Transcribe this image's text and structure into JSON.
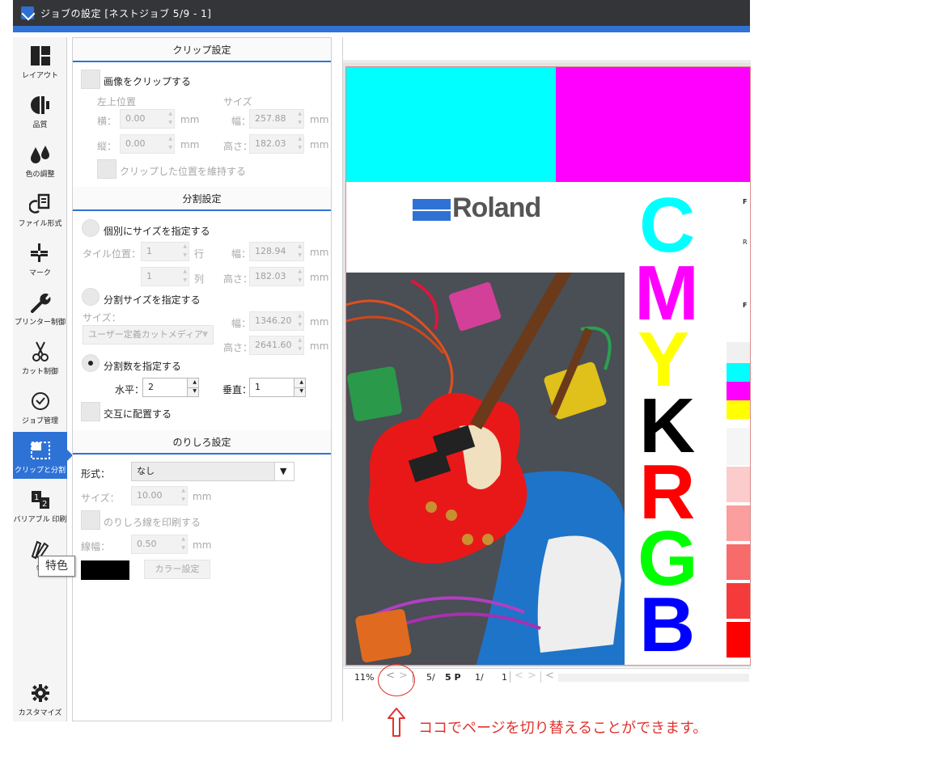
{
  "window": {
    "title": "ジョブの設定 [ネストジョブ 5/9 - 1]"
  },
  "nav": {
    "items": [
      {
        "label": "レイアウト",
        "icon": "layout-icon"
      },
      {
        "label": "品質",
        "icon": "quality-icon"
      },
      {
        "label": "色の調整",
        "icon": "color-drops-icon"
      },
      {
        "label": "ファイル形式",
        "icon": "file-format-icon"
      },
      {
        "label": "マーク",
        "icon": "crop-marks-icon"
      },
      {
        "label": "プリンター制御",
        "icon": "wrench-icon"
      },
      {
        "label": "カット制御",
        "icon": "scissors-icon"
      },
      {
        "label": "ジョブ管理",
        "icon": "clock-icon"
      },
      {
        "label": "クリップと分割",
        "icon": "clip-split-icon",
        "active": true
      },
      {
        "label": "バリアブル 印刷",
        "icon": "variable-print-icon"
      },
      {
        "label": "特",
        "icon": "spot-color-icon"
      }
    ],
    "customize_label": "カスタマイズ"
  },
  "tooltip": "特色",
  "clip": {
    "header": "クリップ設定",
    "clip_image": "画像をクリップする",
    "top_left": "左上位置",
    "size": "サイズ",
    "x_label": "横：",
    "y_label": "縦：",
    "w_label": "幅：",
    "h_label": "高さ：",
    "x": "0.00",
    "y": "0.00",
    "w": "257.88",
    "h": "182.03",
    "unit": "mm",
    "keep_pos": "クリップした位置を維持する"
  },
  "split": {
    "header": "分割設定",
    "individual": "個別にサイズを指定する",
    "tile_pos": "タイル位置：",
    "row_val": "1",
    "row_label": "行",
    "col_val": "1",
    "col_label": "列",
    "w_label": "幅：",
    "h_label": "高さ：",
    "tile_w": "128.94",
    "tile_h": "182.03",
    "split_size": "分割サイズを指定する",
    "size_label": "サイズ：",
    "media": "ユーザー定義カットメディア",
    "media_w": "1346.20",
    "media_h": "2641.60",
    "split_count": "分割数を指定する",
    "horiz_label": "水平：",
    "horiz_val": "2",
    "vert_label": "垂直：",
    "vert_val": "1",
    "alternate": "交互に配置する",
    "unit": "mm"
  },
  "margin": {
    "header": "のりしろ設定",
    "format_label": "形式：",
    "format_val": "なし",
    "size_label": "サイズ：",
    "size_val": "10.00",
    "print_line": "のりしろ線を印刷する",
    "width_label": "線幅：",
    "width_val": "0.50",
    "color_btn": "カラー設定",
    "unit": "mm"
  },
  "preview": {
    "zoom": "11%",
    "page": "5/",
    "page_total": "5 P",
    "sub_page": "1/",
    "sub_total": "1",
    "logo_text": "Roland",
    "letters": [
      "C",
      "M",
      "Y",
      "K",
      "R",
      "G",
      "B"
    ],
    "side_labels": [
      "F",
      "R",
      "F"
    ],
    "colors": {
      "cyan": "#00ffff",
      "magenta": "#ff00ff",
      "yellow": "#ffff00",
      "black": "#000000",
      "red": "#ff0000",
      "green": "#00ff00",
      "blue": "#0000ff",
      "accent": "#2f72d6"
    }
  },
  "annotation": {
    "text": "ココでページを切り替えることができます。"
  }
}
